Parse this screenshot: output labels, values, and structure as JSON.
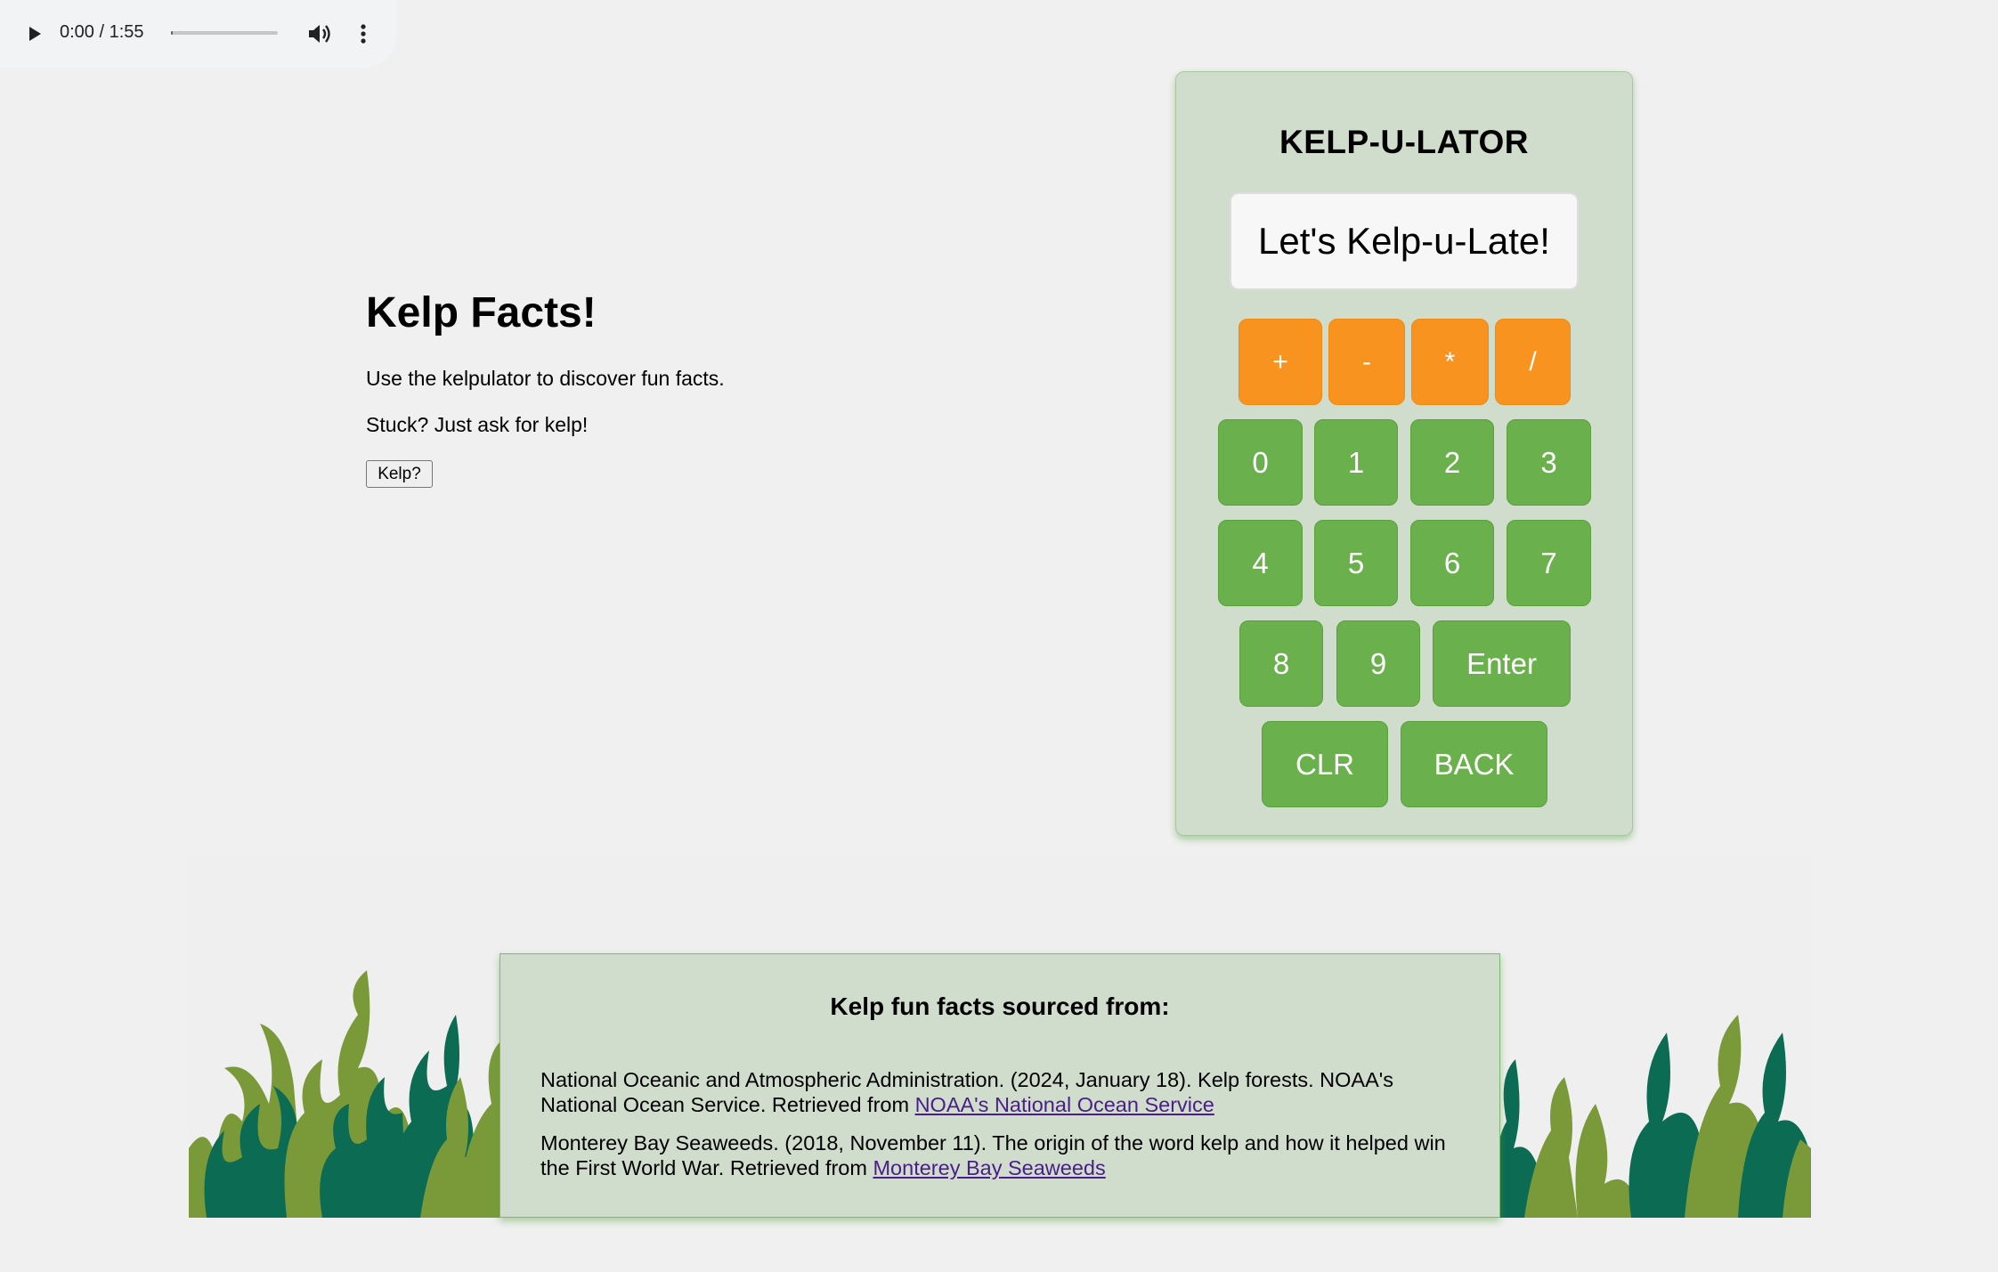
{
  "audio_player": {
    "time": "0:00 / 1:55",
    "icons": [
      "play-icon",
      "volume-icon",
      "more-vert-icon"
    ]
  },
  "facts": {
    "heading": "Kelp Facts!",
    "intro": "Use the kelpulator to discover fun facts.",
    "stuck": "Stuck? Just ask for kelp!",
    "help_button": "Kelp?"
  },
  "calculator": {
    "title": "KELP-U-LATOR",
    "display": "Let's Kelp-u-Late!",
    "operators": [
      "+",
      "-",
      "*",
      "/"
    ],
    "digits_row1": [
      "0",
      "1",
      "2",
      "3"
    ],
    "digits_row2": [
      "4",
      "5",
      "6",
      "7"
    ],
    "row3": [
      "8",
      "9",
      "Enter"
    ],
    "row4": [
      "CLR",
      "BACK"
    ],
    "colors": {
      "operator": "#f7931e",
      "key": "#6ab04c",
      "panel": "#d0dccc"
    }
  },
  "sources": {
    "heading": "Kelp fun facts sourced from:",
    "ref1_text": "National Oceanic and Atmospheric Administration. (2024, January 18). Kelp forests. NOAA's National Ocean Service. Retrieved from ",
    "ref1_link": "NOAA's National Ocean Service",
    "ref2_text": "Monterey Bay Seaweeds. (2018, November 11). The origin of the word kelp and how it helped win the First World War. Retrieved from ",
    "ref2_link": "Monterey Bay Seaweeds"
  }
}
